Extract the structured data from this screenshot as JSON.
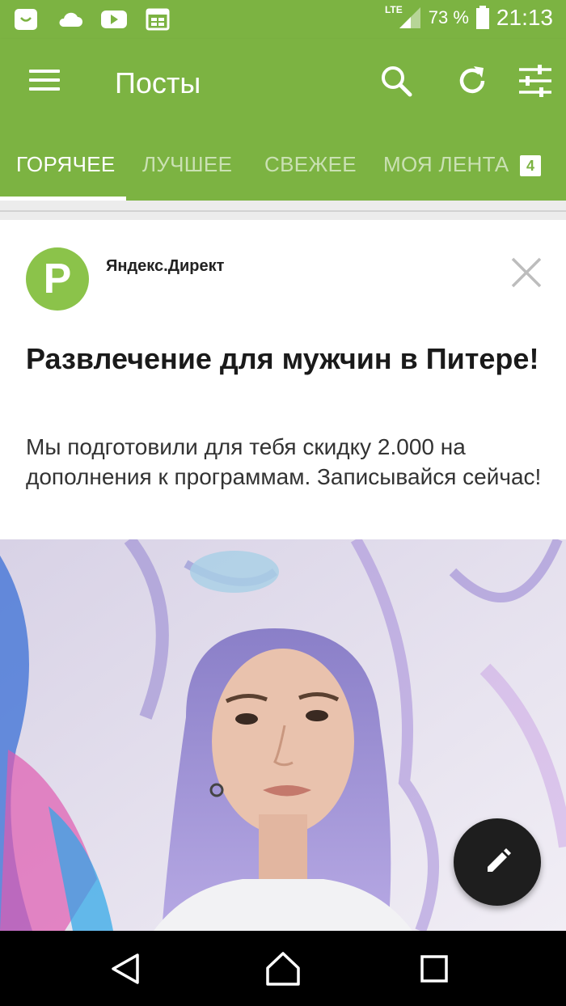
{
  "status_bar": {
    "network": "LTE",
    "battery": "73 %",
    "time": "21:13"
  },
  "app_bar": {
    "title": "Посты"
  },
  "tabs": [
    {
      "label": "ГОРЯЧЕЕ",
      "active": true
    },
    {
      "label": "ЛУЧШЕЕ",
      "active": false
    },
    {
      "label": "СВЕЖЕЕ",
      "active": false
    },
    {
      "label": "МОЯ ЛЕНТА",
      "active": false,
      "badge": "4"
    }
  ],
  "ad_card": {
    "avatar_letter": "P",
    "source": "Яндекс.Директ",
    "title": "Развлечение для мужчин в Питере!",
    "text": "Мы подготовили для тебя скидку 2.000 на дополнения к программам. Записывайся сейчас!"
  },
  "colors": {
    "primary": "#7cb342",
    "avatar": "#8bc34a",
    "fab": "#1e1e1e"
  }
}
